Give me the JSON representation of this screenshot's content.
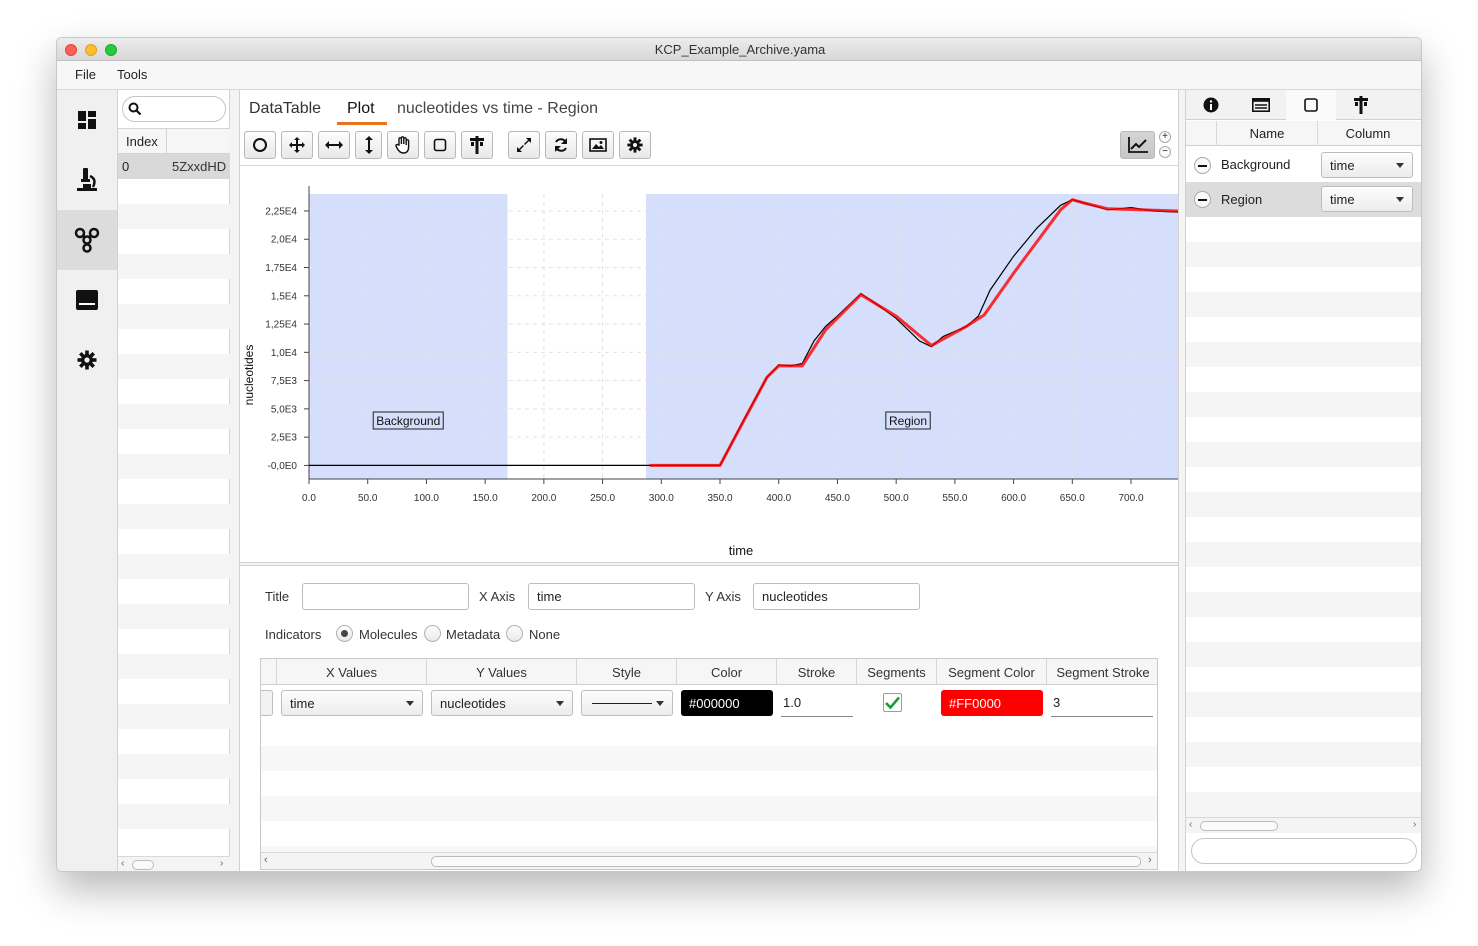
{
  "window": {
    "title": "KCP_Example_Archive.yama",
    "traffic_colors": [
      "#ff5f57",
      "#febc2e",
      "#28c840"
    ]
  },
  "menu": [
    "File",
    "Tools"
  ],
  "nav": {
    "items": [
      "dashboard-icon",
      "microscope-icon",
      "molecules-icon",
      "book-icon",
      "gear-icon"
    ],
    "selected": 2
  },
  "molecules": {
    "search_placeholder": "",
    "columns": [
      "Index",
      ""
    ],
    "rows": [
      [
        "0",
        "5ZxxdHD"
      ]
    ]
  },
  "tabs": {
    "items": [
      "DataTable",
      "Plot"
    ],
    "selected": 1,
    "plot_title": "nucleotides vs time - Region"
  },
  "toolbar": {
    "buttons": [
      "circle-icon",
      "move-icon",
      "horizontal-arrows-icon",
      "vertical-arrows-icon",
      "hand-icon",
      "square-icon",
      "region-icon",
      "expand-icon",
      "refresh-icon",
      "image-icon",
      "gear-icon"
    ],
    "right_button": "line-chart-icon"
  },
  "chart_data": {
    "type": "line",
    "xlabel": "time",
    "ylabel": "nucleotides",
    "xlim": [
      0,
      740
    ],
    "ylim": [
      -1200,
      24000
    ],
    "xticks": [
      0,
      50,
      100,
      150,
      200,
      250,
      300,
      350,
      400,
      450,
      500,
      550,
      600,
      650,
      700
    ],
    "xtick_labels": [
      "0.0",
      "50.0",
      "100.0",
      "150.0",
      "200.0",
      "250.0",
      "300.0",
      "350.0",
      "400.0",
      "450.0",
      "500.0",
      "550.0",
      "600.0",
      "650.0",
      "700.0"
    ],
    "yticks": [
      0,
      2500,
      5000,
      7500,
      10000,
      12500,
      15000,
      17500,
      20000,
      22500
    ],
    "ytick_labels": [
      "-0,0E0",
      "2,5E3",
      "5,0E3",
      "7,5E3",
      "1,0E4",
      "1,25E4",
      "1,5E4",
      "1,75E4",
      "2,0E4",
      "2,25E4"
    ],
    "regions": [
      {
        "name": "Background",
        "x": [
          0,
          169
        ],
        "color": "#d5defa"
      },
      {
        "name": "Region",
        "x": [
          287,
          740
        ],
        "color": "#d5defa"
      }
    ],
    "series": [
      {
        "color": "#000000",
        "x": [
          0,
          50,
          100,
          150,
          200,
          250,
          290,
          320,
          350,
          370,
          390,
          400,
          410,
          420,
          430,
          440,
          450,
          470,
          480,
          500,
          520,
          530,
          540,
          560,
          570,
          580,
          600,
          620,
          640,
          650,
          660,
          680,
          700,
          720,
          740
        ],
        "y": [
          0,
          0,
          0,
          0,
          0,
          0,
          0,
          0,
          0,
          4000,
          7800,
          8900,
          8800,
          9000,
          11000,
          12300,
          13200,
          15200,
          14500,
          13000,
          11000,
          10500,
          11400,
          12300,
          13200,
          15500,
          18500,
          21000,
          23000,
          23500,
          23200,
          22600,
          22800,
          22500,
          22400
        ]
      }
    ],
    "segments": [
      {
        "color": "#FF0000",
        "x": [
          290,
          350,
          390,
          400,
          420,
          440,
          470,
          500,
          530,
          560,
          575,
          600,
          640,
          650,
          660,
          680,
          740
        ],
        "y": [
          0,
          0,
          7800,
          8800,
          8800,
          12000,
          15100,
          13200,
          10600,
          12300,
          13300,
          17000,
          22600,
          23500,
          23200,
          22700,
          22500
        ]
      }
    ]
  },
  "settings": {
    "title_label": "Title",
    "title_value": "",
    "xaxis_label": "X Axis",
    "xaxis_value": "time",
    "yaxis_label": "Y Axis",
    "yaxis_value": "nucleotides",
    "indicators_label": "Indicators",
    "indicator_options": [
      "Molecules",
      "Metadata",
      "None"
    ],
    "indicator_selected": 0
  },
  "series_table": {
    "columns": [
      "X Values",
      "Y Values",
      "Style",
      "Color",
      "Stroke",
      "Segments",
      "Segment Color",
      "Segment Stroke"
    ],
    "row": {
      "x": "time",
      "y": "nucleotides",
      "color": "#000000",
      "stroke": "1.0",
      "segments": true,
      "segment_color": "#FF0000",
      "segment_stroke": "3"
    }
  },
  "regions_panel": {
    "columns": [
      "Name",
      "Column"
    ],
    "rows": [
      {
        "name": "Background",
        "column": "time"
      },
      {
        "name": "Region",
        "column": "time"
      }
    ],
    "selected": 1,
    "tab_icons": [
      "info-icon",
      "table-icon",
      "square-icon",
      "region-icon"
    ],
    "search_placeholder": ""
  }
}
